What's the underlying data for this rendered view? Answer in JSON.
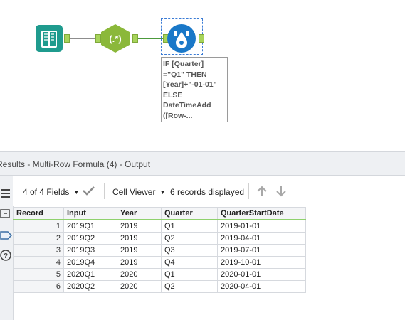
{
  "canvas": {
    "annotation": "IF [Quarter]\n=\"Q1\" THEN\n[Year]+\"-01-01\"\nELSE\nDateTimeAdd\n([Row-..."
  },
  "results": {
    "title": "Results - Multi-Row Formula (4) - Output",
    "fields_label": "4 of 4 Fields",
    "viewer_label": "Cell Viewer",
    "records_label": "6 records displayed"
  },
  "table": {
    "headers": [
      "Record",
      "Input",
      "Year",
      "Quarter",
      "QuarterStartDate"
    ],
    "rows": [
      [
        "1",
        "2019Q1",
        "2019",
        "Q1",
        "2019-01-01"
      ],
      [
        "2",
        "2019Q2",
        "2019",
        "Q2",
        "2019-04-01"
      ],
      [
        "3",
        "2019Q3",
        "2019",
        "Q3",
        "2019-07-01"
      ],
      [
        "4",
        "2019Q4",
        "2019",
        "Q4",
        "2019-10-01"
      ],
      [
        "5",
        "2020Q1",
        "2020",
        "Q1",
        "2020-01-01"
      ],
      [
        "6",
        "2020Q2",
        "2020",
        "Q2",
        "2020-04-01"
      ]
    ]
  },
  "colors": {
    "input_tool": "#1f9b8e",
    "regex_tool": "#8bb83a",
    "multirow_tool": "#1a78c8",
    "anchor": "#a7d45a",
    "header_accent": "#8fd16d"
  },
  "icons": {
    "input_tool": "book-icon",
    "regex_tool": "regex-icon",
    "multirow_tool": "multi-row-formula-icon",
    "check": "check-icon",
    "up": "arrow-up-icon",
    "down": "arrow-down-icon"
  }
}
